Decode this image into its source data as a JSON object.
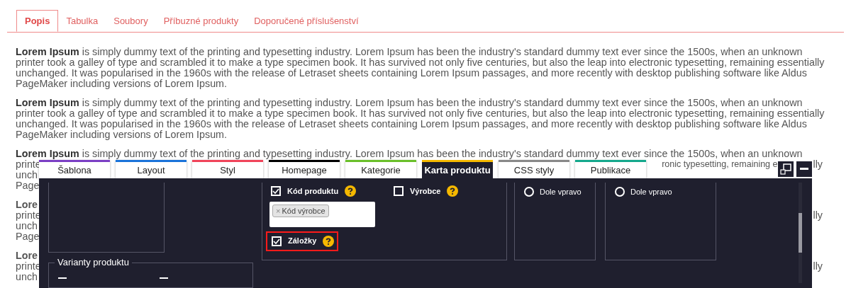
{
  "page_tabs": [
    {
      "label": "Popis",
      "selected": true
    },
    {
      "label": "Tabulka",
      "selected": false
    },
    {
      "label": "Soubory",
      "selected": false
    },
    {
      "label": "Příbuzné produkty",
      "selected": false
    },
    {
      "label": "Doporučené příslušenství",
      "selected": false
    }
  ],
  "paragraphs": [
    {
      "lines": [
        {
          "left": "**Lorem Ipsum** is simply dummy text of the printing and typesetting industry. Lorem Ipsum has been the industry's standard dummy text ever since the 1500s, when an unknown"
        },
        {
          "left": "printer took a galley of type and scrambled it to make a type specimen book. It has survived not only five centuries, but also the leap into electronic typesetting, remaining essentially"
        },
        {
          "left": "unchanged. It was popularised in the 1960s with the release of Letraset sheets containing Lorem Ipsum passages, and more recently with desktop publishing software like Aldus"
        },
        {
          "left": "PageMaker including versions of Lorem Ipsum."
        }
      ]
    },
    {
      "lines": [
        {
          "left": "**Lorem Ipsum** is simply dummy text of the printing and typesetting industry. Lorem Ipsum has been the industry's standard dummy text ever since the 1500s, when an unknown"
        },
        {
          "left": "printer took a galley of type and scrambled it to make a type specimen book. It has survived not only five centuries, but also the leap into electronic typesetting, remaining essentially"
        },
        {
          "left": "unchanged. It was popularised in the 1960s with the release of Letraset sheets containing Lorem Ipsum passages, and more recently with desktop publishing software like Aldus"
        },
        {
          "left": "PageMaker including versions of Lorem Ipsum."
        }
      ]
    },
    {
      "lines": [
        {
          "left": "**Lorem Ipsum** is simply dummy text of the printing and typesetting industry. Lorem Ipsum has been the industry's standard dummy text ever since the 1500s, when an unknown"
        },
        {
          "left": "printe",
          "middle": "ronic typesetting, remaining e",
          "right": "lly"
        },
        {
          "left": "unch"
        },
        {
          "left": "Page"
        }
      ]
    },
    {
      "lines": [
        {
          "left": "Lore",
          "bold": true
        },
        {
          "left": "printe",
          "right": "lly"
        },
        {
          "left": "unch"
        },
        {
          "left": "Page"
        }
      ]
    },
    {
      "lines": [
        {
          "left": "Lore",
          "bold": true
        },
        {
          "left": "printe",
          "right": "lly"
        },
        {
          "left": "unch"
        }
      ]
    }
  ],
  "editor": {
    "tabs": [
      {
        "label": "Šablona",
        "color": "#7b3fc4",
        "selected": false
      },
      {
        "label": "Layout",
        "color": "#1a73d9",
        "selected": false
      },
      {
        "label": "Styl",
        "color": "#f0445a",
        "selected": false
      },
      {
        "label": "Homepage",
        "color": "#000000",
        "selected": false
      },
      {
        "label": "Kategorie",
        "color": "#6abf2a",
        "selected": false
      },
      {
        "label": "Karta produktu",
        "color": "#f5b800",
        "selected": true
      },
      {
        "label": "CSS styly",
        "color": "#888888",
        "selected": false
      },
      {
        "label": "Publikace",
        "color": "#14a88c",
        "selected": false
      }
    ],
    "product_code": {
      "label": "Kód produktu",
      "checked": true,
      "tags": [
        {
          "remove": "×",
          "label": "Kód výrobce"
        }
      ]
    },
    "manufacturer": {
      "label": "Výrobce",
      "checked": false
    },
    "bookmarks": {
      "label": "Záložky",
      "checked": true,
      "highlighted": true
    },
    "positions": [
      {
        "label": "Dole vpravo",
        "selected": false
      },
      {
        "label": "Dole vpravo",
        "selected": false
      }
    ],
    "variants": {
      "legend": "Varianty produktu"
    }
  }
}
